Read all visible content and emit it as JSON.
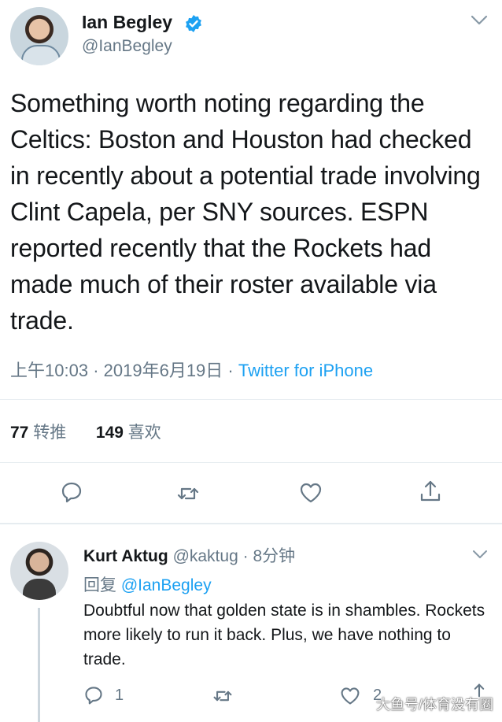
{
  "tweet": {
    "author_name": "Ian Begley",
    "author_handle": "@IanBegley",
    "text": "Something worth noting regarding the Celtics: Boston and Houston had checked in recently about a potential trade involving  Clint Capela, per SNY sources. ESPN reported recently that the Rockets had made much of their roster available via trade.",
    "time": "上午10:03",
    "date": "2019年6月19日",
    "separator": "·",
    "source": "Twitter for iPhone",
    "retweet_count": "77",
    "retweet_label": "转推",
    "like_count": "149",
    "like_label": "喜欢"
  },
  "reply": {
    "author_name": "Kurt Aktug",
    "author_handle": "@kaktug",
    "separator": "·",
    "time_ago": "8分钟",
    "replying_label": "回复",
    "replying_to": "@IanBegley",
    "text": "Doubtful now that golden state is in shambles. Rockets more likely to run it back. Plus, we have nothing to trade.",
    "reply_count": "1",
    "like_count": "2"
  },
  "watermark": "大鱼号/体育没有圈",
  "colors": {
    "accent": "#1da1f2",
    "secondary_text": "#657786",
    "divider": "#e6ecf0"
  }
}
